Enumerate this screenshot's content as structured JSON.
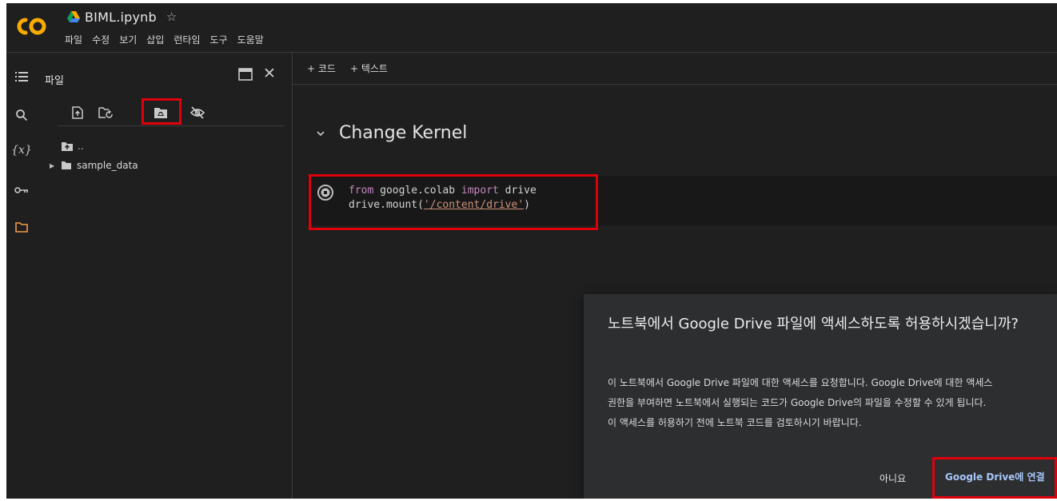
{
  "app": {
    "logo_text": "CO",
    "notebook_title": "BIML.ipynb",
    "menu": [
      "파일",
      "수정",
      "보기",
      "삽입",
      "런타임",
      "도구",
      "도움말"
    ]
  },
  "file_panel": {
    "title": "파일",
    "tree": [
      {
        "label": ".."
      },
      {
        "label": "sample_data"
      }
    ]
  },
  "main": {
    "toolbar": {
      "add_code": "+ 코드",
      "add_text": "+ 텍스트"
    },
    "section_title": "Change Kernel",
    "code": {
      "line1_kw1": "from",
      "line1_mod": " google.colab ",
      "line1_kw2": "import",
      "line1_name": " drive",
      "line2_call": "drive.mount(",
      "line2_str": "'/content/drive'",
      "line2_close": ")"
    }
  },
  "dialog": {
    "title": "노트북에서 Google Drive 파일에 액세스하도록 허용하시겠습니까?",
    "body_lines": [
      "이 노트북에서 Google Drive 파일에 대한 액세스를 요청합니다. Google Drive에 대한 액세스",
      "권한을 부여하면 노트북에서 실행되는 코드가 Google Drive의 파일을 수정할 수 있게 됩니다.",
      "이 액세스를 허용하기 전에 노트북 코드를 검토하시기 바랍니다."
    ],
    "no_label": "아니요",
    "connect_label": "Google Drive에 연결"
  },
  "colors": {
    "highlight": "#e0000b",
    "logo_orange": "#f9ab00",
    "folder_accent": "#f2994a",
    "link_blue": "#a8c7fa"
  }
}
